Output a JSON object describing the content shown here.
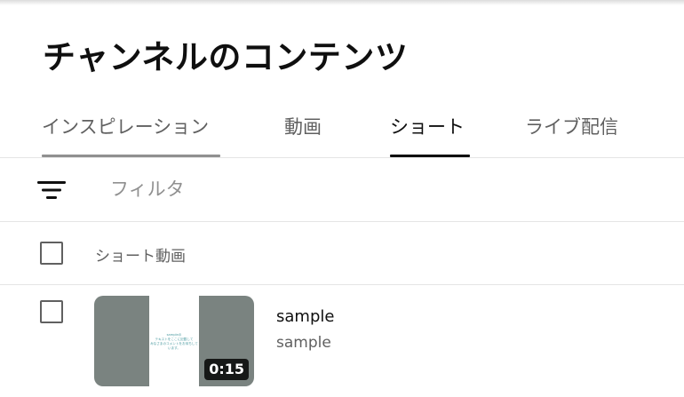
{
  "page": {
    "title": "チャンネルのコンテンツ"
  },
  "tabs": [
    {
      "label": "インスピレーション",
      "selected": false
    },
    {
      "label": "動画",
      "selected": false
    },
    {
      "label": "ショート",
      "selected": true
    },
    {
      "label": "ライブ配信",
      "selected": false
    }
  ],
  "filter": {
    "icon": "filter-list-icon",
    "placeholder": "フィルタ",
    "value": ""
  },
  "table": {
    "header_label": "ショート動画",
    "rows": [
      {
        "title": "sample",
        "description": "sample",
        "duration": "0:15",
        "thumbnail_text": "sampleの\nテキストをここに記載して\nみなさまのコメントをお待ちしています。"
      }
    ]
  },
  "colors": {
    "text_primary": "#0f0f0f",
    "text_secondary": "#606060",
    "divider": "#e5e5e5",
    "thumbnail_side": "#7a8380",
    "accent_thumbnail_text": "#4a9aa0"
  }
}
